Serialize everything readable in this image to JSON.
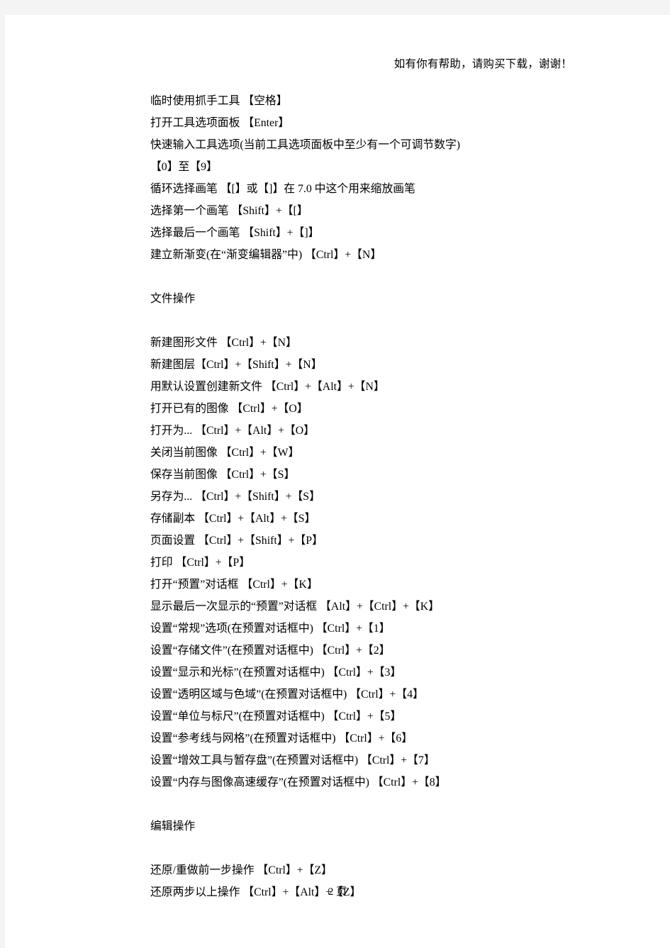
{
  "document": {
    "header_note": "如有你有帮助，请购买下载，谢谢！",
    "page_number": "2 页"
  },
  "blocks": [
    {
      "id": "tool-shortcuts",
      "lines": [
        "临时使用抓手工具  【空格】",
        "打开工具选项面板  【Enter】",
        "快速输入工具选项(当前工具选项面板中至少有一个可调节数字)  【0】至【9】",
        "循环选择画笔  【[】或【]】在 7.0 中这个用来缩放画笔",
        "选择第一个画笔  【Shift】+【[】",
        "选择最后一个画笔  【Shift】+【]】",
        "建立新渐变(在“渐变编辑器”中)  【Ctrl】+【N】"
      ]
    },
    {
      "id": "file-operations",
      "heading": "文件操作",
      "lines": [
        "新建图形文件  【Ctrl】+【N】",
        "新建图层【Ctrl】+【Shift】+【N】",
        "用默认设置创建新文件  【Ctrl】+【Alt】+【N】",
        "打开已有的图像  【Ctrl】+【O】",
        "打开为...  【Ctrl】+【Alt】+【O】",
        "关闭当前图像  【Ctrl】+【W】",
        "保存当前图像  【Ctrl】+【S】",
        "另存为...  【Ctrl】+【Shift】+【S】",
        "存储副本  【Ctrl】+【Alt】+【S】",
        "页面设置  【Ctrl】+【Shift】+【P】",
        "打印  【Ctrl】+【P】",
        "打开“预置”对话框  【Ctrl】+【K】",
        "显示最后一次显示的“预置”对话框  【Alt】+【Ctrl】+【K】",
        "设置“常规”选项(在预置对话框中)  【Ctrl】+【1】",
        "设置“存储文件”(在预置对话框中)  【Ctrl】+【2】",
        "设置“显示和光标”(在预置对话框中)  【Ctrl】+【3】",
        "设置“透明区域与色域”(在预置对话框中)  【Ctrl】+【4】",
        "设置“单位与标尺”(在预置对话框中)  【Ctrl】+【5】",
        "设置“参考线与网格”(在预置对话框中)  【Ctrl】+【6】",
        "设置“增效工具与暂存盘”(在预置对话框中)  【Ctrl】+【7】",
        "设置“内存与图像高速缓存”(在预置对话框中)  【Ctrl】+【8】"
      ]
    },
    {
      "id": "edit-operations",
      "heading": "编辑操作",
      "lines": [
        "还原/重做前一步操作  【Ctrl】+【Z】",
        "还原两步以上操作  【Ctrl】+【Alt】+【Z】"
      ]
    }
  ]
}
